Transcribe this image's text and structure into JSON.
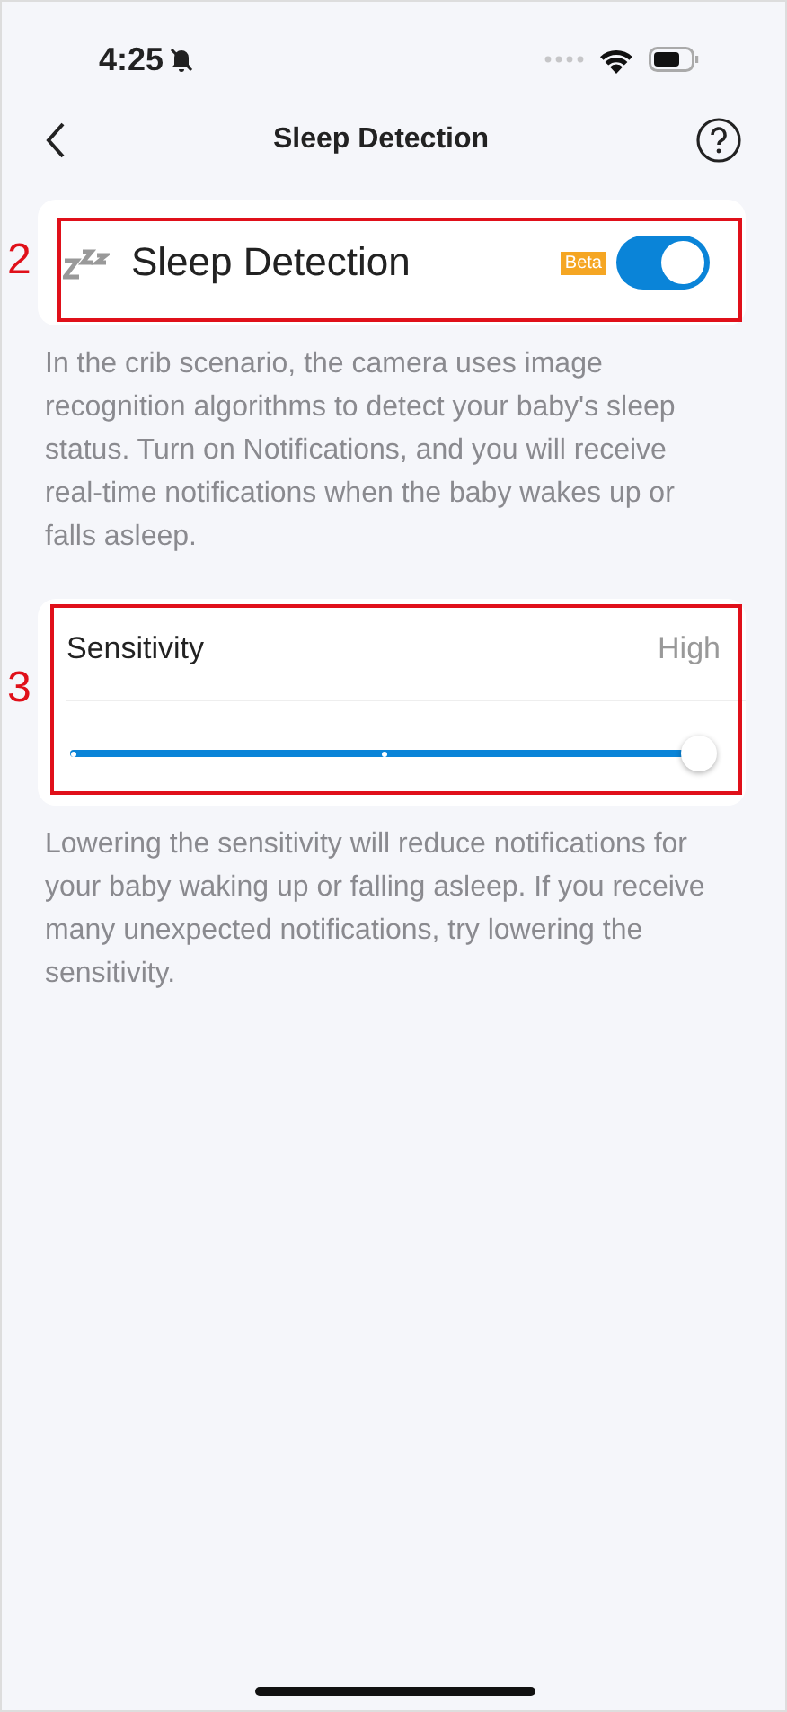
{
  "status_bar": {
    "time": "4:25",
    "silent": true
  },
  "nav": {
    "title": "Sleep Detection"
  },
  "sleep_card": {
    "label": "Sleep Detection",
    "badge": "Beta",
    "on": true,
    "annotation": "2"
  },
  "sleep_description": "In the crib scenario, the camera uses image recognition algorithms to detect your baby's sleep status. Turn on Notifications, and you will receive real-time notifications when the baby wakes up or falls asleep.",
  "sensitivity_card": {
    "label": "Sensitivity",
    "value": "High",
    "level": 1,
    "annotation": "3"
  },
  "sensitivity_description": "Lowering the sensitivity will reduce notifications for your baby waking up or falling asleep. If you receive many unexpected notifications, try lowering the sensitivity."
}
